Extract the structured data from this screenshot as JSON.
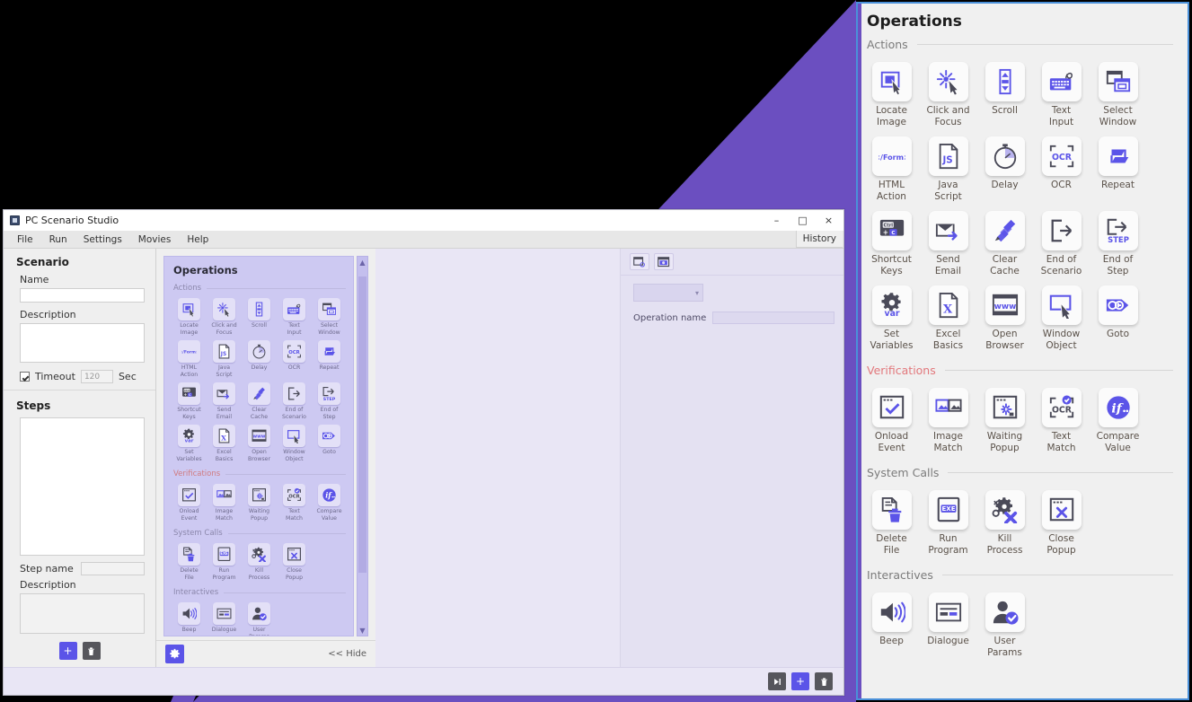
{
  "window": {
    "title": "PC Scenario Studio",
    "app_icon": "app-window-icon",
    "minimize": "–",
    "maximize": "□",
    "close": "×",
    "menus": [
      "File",
      "Run",
      "Settings",
      "Movies",
      "Help"
    ],
    "history_label": "History"
  },
  "scenario_panel": {
    "heading": "Scenario",
    "name_label": "Name",
    "name_value": "",
    "description_label": "Description",
    "description_value": "",
    "timeout_label": "Timeout",
    "timeout_value": "120",
    "timeout_unit": "Sec",
    "timeout_checked": true,
    "steps_heading": "Steps",
    "step_name_label": "Step name",
    "step_name_value": "",
    "step_description_label": "Description",
    "step_description_value": "",
    "add_button": "+",
    "delete_button": "trash-icon"
  },
  "ops_panel_inapp": {
    "heading": "Operations",
    "gear_button": "gear-icon",
    "hide_label": "<< Hide"
  },
  "inspector": {
    "toolbar_icons": [
      "window-target-icon",
      "screenshot-icon"
    ],
    "select_value": "",
    "operation_name_label": "Operation name",
    "operation_name_value": ""
  },
  "app_bottom_toolbar": {
    "buttons": [
      "step-forward-icon",
      "add-icon",
      "trash-icon"
    ]
  },
  "operations": {
    "title": "Operations",
    "groups": [
      {
        "label": "Actions",
        "label_color": "#7b7b7b",
        "items": [
          {
            "label": "Locate\nImage",
            "label_l1": "Locate",
            "label_l2": "Image",
            "icon": "locate-image-icon"
          },
          {
            "label": "Click and\nFocus",
            "label_l1": "Click and",
            "label_l2": "Focus",
            "icon": "click-and-focus-icon"
          },
          {
            "label": "Scroll",
            "label_l1": "Scroll",
            "label_l2": "",
            "icon": "scroll-icon"
          },
          {
            "label": "Text\nInput",
            "label_l1": "Text",
            "label_l2": "Input",
            "icon": "text-input-icon"
          },
          {
            "label": "Select\nWindow",
            "label_l1": "Select",
            "label_l2": "Window",
            "icon": "select-window-icon"
          },
          {
            "label": "HTML\nAction",
            "label_l1": "HTML",
            "label_l2": "Action",
            "icon": "html-action-icon"
          },
          {
            "label": "Java\nScript",
            "label_l1": "Java",
            "label_l2": "Script",
            "icon": "java-script-icon"
          },
          {
            "label": "Delay",
            "label_l1": "Delay",
            "label_l2": "",
            "icon": "delay-icon"
          },
          {
            "label": "OCR",
            "label_l1": "OCR",
            "label_l2": "",
            "icon": "ocr-icon"
          },
          {
            "label": "Repeat",
            "label_l1": "Repeat",
            "label_l2": "",
            "icon": "repeat-icon"
          },
          {
            "label": "Shortcut\nKeys",
            "label_l1": "Shortcut",
            "label_l2": "Keys",
            "icon": "shortcut-keys-icon"
          },
          {
            "label": "Send\nEmail",
            "label_l1": "Send",
            "label_l2": "Email",
            "icon": "send-email-icon"
          },
          {
            "label": "Clear\nCache",
            "label_l1": "Clear",
            "label_l2": "Cache",
            "icon": "clear-cache-icon"
          },
          {
            "label": "End of\nScenario",
            "label_l1": "End of",
            "label_l2": "Scenario",
            "icon": "end-of-scenario-icon"
          },
          {
            "label": "End of\nStep",
            "label_l1": "End of",
            "label_l2": "Step",
            "icon": "end-of-step-icon"
          },
          {
            "label": "Set\nVariables",
            "label_l1": "Set",
            "label_l2": "Variables",
            "icon": "set-variables-icon"
          },
          {
            "label": "Excel\nBasics",
            "label_l1": "Excel",
            "label_l2": "Basics",
            "icon": "excel-basics-icon"
          },
          {
            "label": "Open\nBrowser",
            "label_l1": "Open",
            "label_l2": "Browser",
            "icon": "open-browser-icon"
          },
          {
            "label": "Window\nObject",
            "label_l1": "Window",
            "label_l2": "Object",
            "icon": "window-object-icon"
          },
          {
            "label": "Goto",
            "label_l1": "Goto",
            "label_l2": "",
            "icon": "goto-icon"
          }
        ]
      },
      {
        "label": "Verifications",
        "label_color": "#e2787c",
        "items": [
          {
            "label": "Onload\nEvent",
            "label_l1": "Onload",
            "label_l2": "Event",
            "icon": "onload-event-icon"
          },
          {
            "label": "Image\nMatch",
            "label_l1": "Image",
            "label_l2": "Match",
            "icon": "image-match-icon"
          },
          {
            "label": "Waiting\nPopup",
            "label_l1": "Waiting",
            "label_l2": "Popup",
            "icon": "waiting-popup-icon"
          },
          {
            "label": "Text\nMatch",
            "label_l1": "Text",
            "label_l2": "Match",
            "icon": "text-match-icon"
          },
          {
            "label": "Compare\nValue",
            "label_l1": "Compare",
            "label_l2": "Value",
            "icon": "compare-value-icon"
          }
        ]
      },
      {
        "label": "System Calls",
        "label_color": "#7b7b7b",
        "items": [
          {
            "label": "Delete\nFile",
            "label_l1": "Delete",
            "label_l2": "File",
            "icon": "delete-file-icon"
          },
          {
            "label": "Run\nProgram",
            "label_l1": "Run",
            "label_l2": "Program",
            "icon": "run-program-icon"
          },
          {
            "label": "Kill\nProcess",
            "label_l1": "Kill",
            "label_l2": "Process",
            "icon": "kill-process-icon"
          },
          {
            "label": "Close\nPopup",
            "label_l1": "Close",
            "label_l2": "Popup",
            "icon": "close-popup-icon"
          }
        ]
      },
      {
        "label": "Interactives",
        "label_color": "#7b7b7b",
        "items": [
          {
            "label": "Beep",
            "label_l1": "Beep",
            "label_l2": "",
            "icon": "beep-icon"
          },
          {
            "label": "Dialogue",
            "label_l1": "Dialogue",
            "label_l2": "",
            "icon": "dialogue-icon"
          },
          {
            "label": "User\nParams",
            "label_l1": "User",
            "label_l2": "Params",
            "icon": "user-params-icon"
          }
        ]
      }
    ]
  },
  "colors": {
    "accent_blue": "#5b54e8",
    "highlight_purple": "#6b4fc0",
    "zoom_border": "#4a90d9",
    "verif_label": "#e2787c",
    "background": "#000000"
  }
}
